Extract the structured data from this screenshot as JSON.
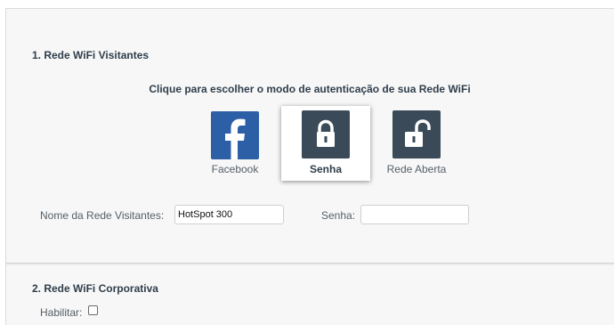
{
  "section1": {
    "title": "1. Rede WiFi Visitantes",
    "subtitle": "Clique para escolher o modo de autenticação de sua Rede WiFi",
    "auth_options": [
      {
        "label": "Facebook",
        "icon": "facebook-icon",
        "color": "#2d5fa6",
        "selected": false
      },
      {
        "label": "Senha",
        "icon": "lock-closed-icon",
        "color": "#3a4a58",
        "selected": true
      },
      {
        "label": "Rede Aberta",
        "icon": "lock-open-icon",
        "color": "#3a4a58",
        "selected": false
      }
    ],
    "network_name_label": "Nome da Rede Visitantes:",
    "network_name_value": "HotSpot 300",
    "password_label": "Senha:",
    "password_value": ""
  },
  "section2": {
    "title": "2. Rede WiFi Corporativa",
    "enable_label": "Habilitar:",
    "enable_checked": false
  }
}
